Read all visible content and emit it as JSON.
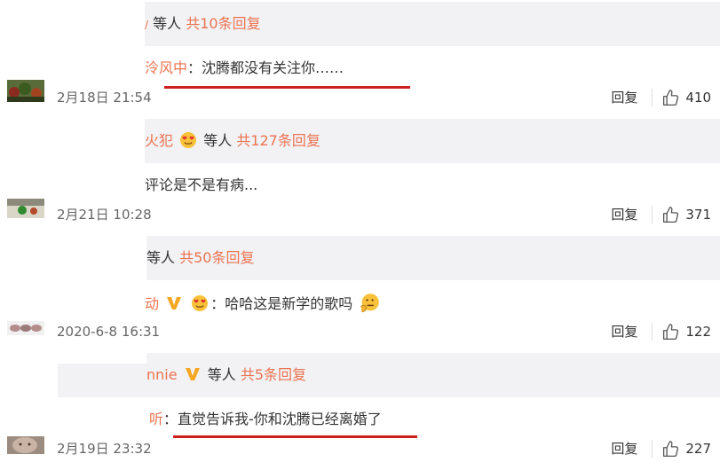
{
  "comments": [
    {
      "reply_names": "",
      "reply_suffix": "等人",
      "reply_count": "共10条回复",
      "author": "泠风中",
      "colon": "：",
      "text": "沈腾都没有关注你……",
      "time": "2月18日 21:54",
      "reply_label": "回复",
      "likes": "410"
    },
    {
      "reply_names": "火犯",
      "reply_suffix": "等人",
      "reply_count": "共127条回复",
      "author": "",
      "colon": "",
      "text": "评论是不是有病...",
      "time": "2月21日 10:28",
      "reply_label": "回复",
      "likes": "371"
    },
    {
      "reply_names": "",
      "reply_suffix": "等人",
      "reply_count": "共50条回复",
      "author": "动",
      "colon": "：",
      "text": "哈哈这是新学的歌吗",
      "time": "2020-6-8 16:31",
      "reply_label": "回复",
      "likes": "122"
    },
    {
      "reply_names": "nnie",
      "reply_suffix": "等人",
      "reply_count": "共5条回复",
      "author": "听",
      "colon": "：",
      "text": "直觉告诉我-你和沈腾已经离婚了",
      "time": "2月19日 23:32",
      "reply_label": "回复",
      "likes": "227"
    }
  ],
  "colors": {
    "accent": "#eb7350",
    "underline": "#cc1f1f",
    "reply_bg": "#f2f2f5",
    "vip_badge": "#f5a623"
  }
}
